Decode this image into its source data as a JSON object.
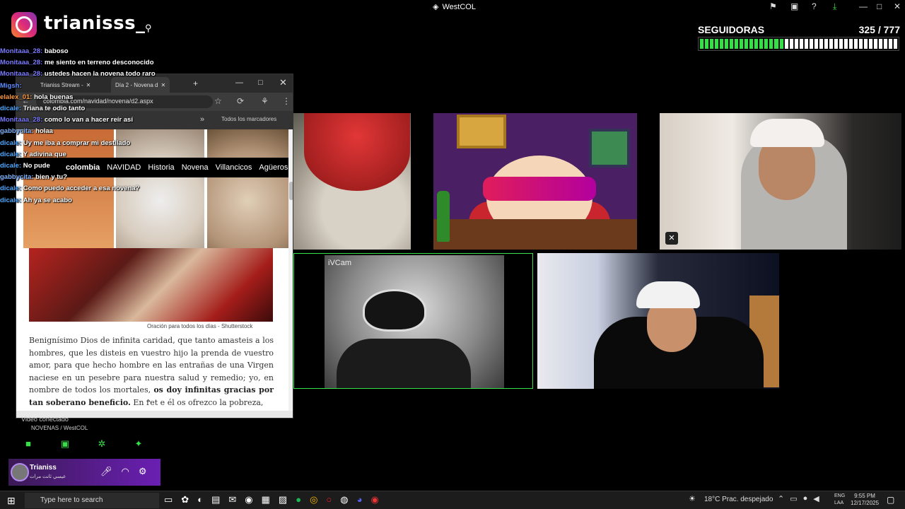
{
  "window": {
    "title": "WestCOL",
    "controls": [
      "⚑",
      "▣",
      "?",
      "⤓",
      "—",
      "□",
      "✕"
    ]
  },
  "instagram": {
    "username": "trianisss_"
  },
  "followers": {
    "label": "SEGUIDORAS",
    "count": "325 / 777",
    "progress_fraction": 0.42
  },
  "chat": [
    {
      "user": "Monitaaa_28:",
      "message": "baboso",
      "color": "#7a7aff"
    },
    {
      "user": "Monitaaa_28:",
      "message": "me siento en terreno desconocido",
      "color": "#7a7aff"
    },
    {
      "user": "Monitaaa_28:",
      "message": "ustedes hacen la novena todo raro",
      "color": "#7a7aff"
    },
    {
      "user": "Migsh:",
      "message": "",
      "color": "#5b8cff"
    },
    {
      "user": "elalex_01:",
      "message": "hola buenas",
      "color": "#ff9a3c"
    },
    {
      "user": "dicale:",
      "message": "Triana te odio tanto",
      "color": "#4aa8ff"
    },
    {
      "user": "Monitaaa_28:",
      "message": "como lo van a hacer reír así",
      "color": "#7a7aff"
    },
    {
      "user": "gabbycita:",
      "message": "holaa",
      "color": "#7fb3ff"
    },
    {
      "user": "dicale:",
      "message": "Uy me iba a comprar mi destilado",
      "color": "#4aa8ff"
    },
    {
      "user": "dicale:",
      "message": "Y adivina que",
      "color": "#4aa8ff"
    },
    {
      "user": "dicale:",
      "message": "No pude",
      "color": "#4aa8ff"
    },
    {
      "user": "gabbycita:",
      "message": "bien y tu?",
      "color": "#7fb3ff"
    },
    {
      "user": "dicale:",
      "message": "Como puedo acceder a esa novena?",
      "color": "#4aa8ff"
    },
    {
      "user": "dicale:",
      "message": "Ah ya se acabo",
      "color": "#4aa8ff"
    }
  ],
  "browser": {
    "tabs": [
      {
        "label": "Trianiss Stream -"
      },
      {
        "label": "Día 2 - Novena d"
      }
    ],
    "new_tab": "+",
    "url": "colombia.com/navidad/novena/d2.aspx",
    "bookmarks_label": "Todos los marcadores",
    "site_logo": "colombia",
    "nav": [
      "NAVIDAD",
      "Historia",
      "Novena",
      "Villancicos",
      "Agüeros"
    ],
    "caption": "Oración para todos los días - Shutterstock",
    "article_text": "Benignísimo Dios de infinita caridad, que tanto amasteis a los hombres, que les disteis en vuestro hijo la prenda de vuestro amor, para que hecho hombre en las entrañas de una Virgen naciese en un pesebre para nuestra salud y remedio; yo, en nombre de todos los mortales,",
    "article_bold_1": "os doy infinitas gracias por tan soberano beneficio.",
    "article_tail": "En ret      e él os ofrezco la pobreza,"
  },
  "tiles": {
    "ivcam_label": "iVCam"
  },
  "discord": {
    "status": "Video conectado",
    "channel": "NOVENAS / WestCOL",
    "user": "Trianiss",
    "subtitle": "عيسي ثانت مرات"
  },
  "taskbar": {
    "search_placeholder": "Type here to search",
    "weather": "18°C  Prac. despejado",
    "lang_top": "ENG",
    "lang_bottom": "LAA",
    "time": "9:55 PM",
    "date": "12/17/2025"
  },
  "colors": {
    "accent_green": "#33e046",
    "browser_nav": "#000000"
  }
}
